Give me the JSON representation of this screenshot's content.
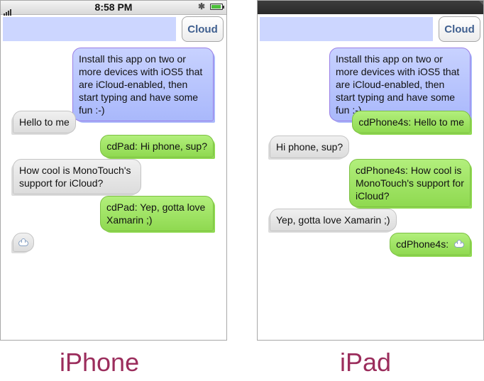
{
  "iphone": {
    "status": {
      "time": "8:58 PM"
    },
    "toolbar": {
      "message_value": "",
      "cloud_label": "Cloud"
    },
    "messages": [
      {
        "side": "right",
        "style": "blue",
        "text": "Install this app on two or more devices with iOS5 that are iCloud-enabled, then start typing and have some fun :-)"
      },
      {
        "side": "left",
        "style": "gray",
        "text": "Hello to me"
      },
      {
        "side": "right",
        "style": "green",
        "text": "cdPad: Hi phone, sup?"
      },
      {
        "side": "left",
        "style": "gray",
        "text": "How cool is MonoTouch's support for iCloud?"
      },
      {
        "side": "right",
        "style": "green",
        "text": "cdPad: Yep, gotta love Xamarin ;)"
      },
      {
        "side": "left",
        "style": "gray",
        "text": "",
        "icon": "cloud-icon"
      }
    ],
    "caption": "iPhone"
  },
  "ipad": {
    "toolbar": {
      "message_value": "",
      "cloud_label": "Cloud"
    },
    "messages": [
      {
        "side": "right",
        "style": "blue",
        "text": "Install this app on two or more devices with iOS5 that are iCloud-enabled, then start typing and have some fun :-)"
      },
      {
        "side": "right",
        "style": "green",
        "text": "cdPhone4s: Hello to me"
      },
      {
        "side": "left",
        "style": "gray",
        "text": "Hi phone, sup?"
      },
      {
        "side": "right",
        "style": "green",
        "text": "cdPhone4s: How cool is MonoTouch's support for iCloud?"
      },
      {
        "side": "left",
        "style": "gray",
        "text": "Yep, gotta love Xamarin ;)"
      },
      {
        "side": "right",
        "style": "green",
        "text": "cdPhone4s: ",
        "icon": "cloud-icon"
      }
    ],
    "caption": "iPad"
  },
  "colors": {
    "bubble_blue": "#a9b8fb",
    "bubble_green": "#8fd950",
    "bubble_gray": "#dcdcdc",
    "message_field": "#ccd6ff",
    "caption": "#9b2d5c"
  }
}
